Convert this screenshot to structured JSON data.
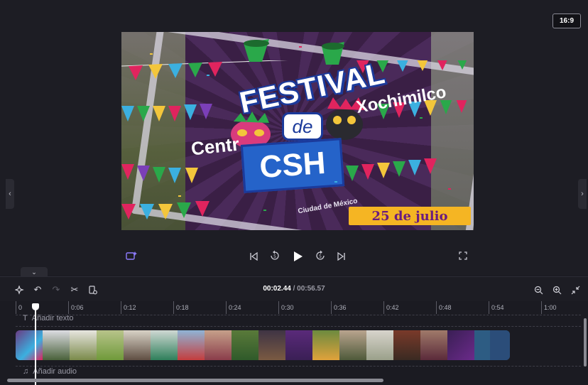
{
  "preview": {
    "aspect_ratio": "16:9",
    "video_text": {
      "festival": "FESTIVAL",
      "de": "de",
      "csh": "CSH",
      "xochimilco": "Xochimilco",
      "centro": "Centr",
      "city": "Ciudad de México",
      "date": "25 de julio"
    }
  },
  "controls": {
    "camera": "camera-sparkle-icon",
    "prev": "skip-back-icon",
    "back5": "rewind-5-icon",
    "play": "play-icon",
    "fwd5": "forward-5-icon",
    "next": "skip-forward-icon",
    "fullscreen": "fullscreen-icon"
  },
  "toolbar": {
    "current_time": "00:02.44",
    "separator": "/",
    "total_time": "00:56.57"
  },
  "ruler": {
    "labels": [
      "0",
      "0:06",
      "0:12",
      "0:18",
      "0:24",
      "0:30",
      "0:36",
      "0:42",
      "0:48",
      "0:54",
      "1:00"
    ]
  },
  "tracks": {
    "add_text": "Añadir texto",
    "add_audio": "Añadir audio",
    "text_glyph": "T",
    "audio_glyph": "♫"
  },
  "colors": {
    "accent": "#8e7cff",
    "clip_blue": "#2b4d79",
    "date_banner": "#f5b523"
  }
}
